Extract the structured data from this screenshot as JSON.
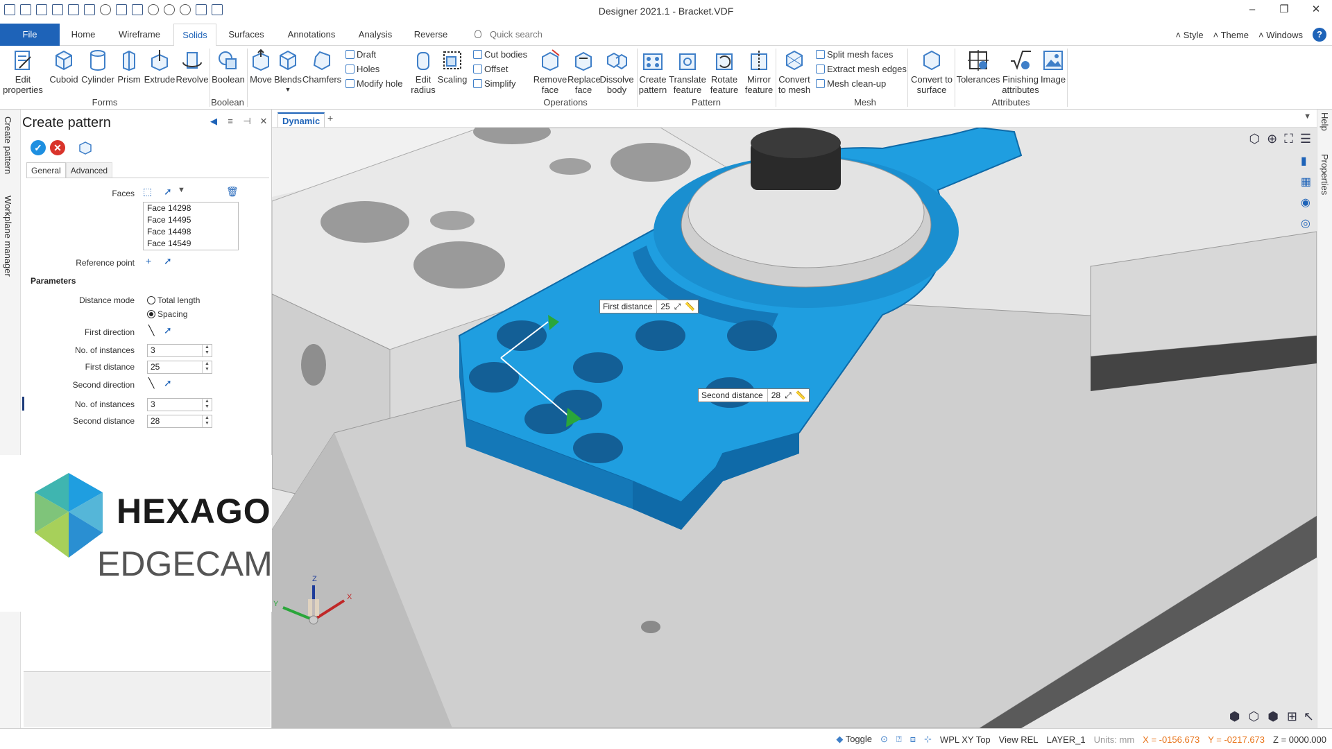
{
  "window": {
    "title": "Designer 2021.1 - Bracket.VDF",
    "controls": [
      "–",
      "❐",
      "✕"
    ]
  },
  "tabs": [
    "File",
    "Home",
    "Wireframe",
    "Solids",
    "Surfaces",
    "Annotations",
    "Analysis",
    "Reverse"
  ],
  "quick_search": "Quick search",
  "menus": {
    "style": "Style",
    "theme": "Theme",
    "windows": "Windows",
    "help": "?"
  },
  "ribbon": {
    "buttons": {
      "edit_properties": "Edit properties",
      "cuboid": "Cuboid",
      "cylinder": "Cylinder",
      "prism": "Prism",
      "extrude": "Extrude",
      "revolve": "Revolve",
      "boolean": "Boolean",
      "move": "Move",
      "blends": "Blends",
      "chamfers": "Chamfers",
      "draft": "Draft",
      "holes": "Holes",
      "modify_hole": "Modify hole",
      "edit_radius": "Edit radius",
      "scaling": "Scaling",
      "cut_bodies": "Cut bodies",
      "offset": "Offset",
      "simplify": "Simplify",
      "remove_face": "Remove face",
      "replace_face": "Replace face",
      "dissolve_body": "Dissolve body",
      "create_pattern": "Create pattern",
      "translate_feature": "Translate feature",
      "rotate_feature": "Rotate feature",
      "mirror_feature": "Mirror feature",
      "convert_to_mesh": "Convert to mesh",
      "split_mesh_faces": "Split mesh faces",
      "extract_mesh_edges": "Extract mesh edges",
      "mesh_cleanup": "Mesh clean-up",
      "convert_to_surface": "Convert to surface",
      "tolerances": "Tolerances",
      "finishing_attributes": "Finishing attributes",
      "image": "Image"
    },
    "groups": [
      "Forms",
      "Boolean",
      "Operations",
      "Pattern",
      "Mesh",
      "Attributes"
    ]
  },
  "left_strip": {
    "create_pattern": "Create pattern",
    "workplane_manager": "Workplane manager"
  },
  "panel": {
    "title": "Create pattern",
    "tabs": {
      "general": "General",
      "advanced": "Advanced"
    },
    "faces_label": "Faces",
    "faces": [
      "Face 14298",
      "Face 14495",
      "Face 14498",
      "Face 14549"
    ],
    "reference_point": "Reference point",
    "parameters": "Parameters",
    "distance_mode": "Distance mode",
    "mode_total": "Total length",
    "mode_spacing": "Spacing",
    "selected_mode": "Spacing",
    "first_direction": "First direction",
    "no_instances": "No. of instances",
    "first_instances": "3",
    "first_distance_label": "First distance",
    "first_distance": "25",
    "second_direction": "Second direction",
    "second_instances": "3",
    "second_distance_label": "Second distance",
    "second_distance": "28"
  },
  "logo": {
    "brand": "HEXAGON",
    "product": "EDGECAM"
  },
  "viewport": {
    "tab": "Dynamic",
    "callout_first": {
      "label": "First distance",
      "value": "25"
    },
    "callout_second": {
      "label": "Second distance",
      "value": "28"
    },
    "axes": {
      "x": "X",
      "y": "Y",
      "z": "Z"
    }
  },
  "right_strip": {
    "help": "Help",
    "properties": "Properties"
  },
  "status": {
    "toggle": "Toggle",
    "wpl": "WPL XY Top",
    "view": "View REL",
    "layer": "LAYER_1",
    "units": "Units: mm",
    "x": "X = -0156.673",
    "y": "Y = -0217.673",
    "z": "Z = 0000.000"
  },
  "colors": {
    "accent": "#1e63b8",
    "part_blue": "#1f9ee0",
    "cancel_red": "#d9342b",
    "coord_orange": "#e8741a"
  }
}
